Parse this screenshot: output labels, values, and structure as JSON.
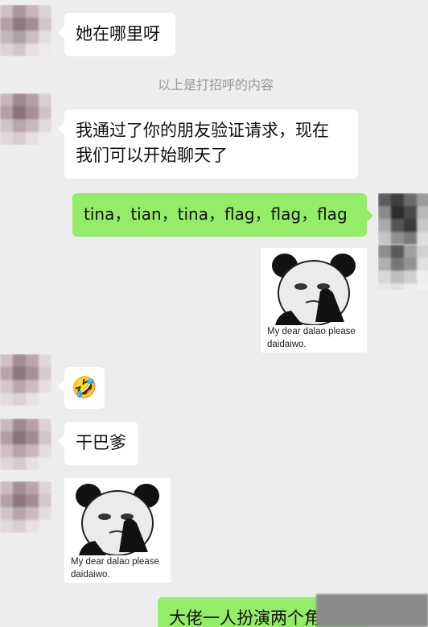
{
  "messages": [
    {
      "side": "in",
      "type": "text",
      "text": "她在哪里呀"
    },
    {
      "type": "system",
      "text": "以上是打招呼的内容"
    },
    {
      "side": "in",
      "type": "text",
      "lines": [
        "我通过了你的朋友验证请求，现在",
        "我们可以开始聊天了"
      ]
    },
    {
      "side": "out",
      "type": "text",
      "text": "tina，tian，tina，flag，flag，flag"
    },
    {
      "side": "out",
      "type": "sticker",
      "caption": "My dear dalao please\ndaidaiwo."
    },
    {
      "side": "in",
      "type": "emoji",
      "emoji": "🤣",
      "icon": "rofl-emoji-icon"
    },
    {
      "side": "in",
      "type": "text",
      "text": "干巴爹"
    },
    {
      "side": "in",
      "type": "sticker",
      "caption": "My dear dalao please\ndaidaiwo."
    },
    {
      "side": "out",
      "type": "text",
      "text": "大佬一人扮演两个角色？"
    }
  ],
  "colors": {
    "background": "#ededed",
    "incoming_bubble": "#ffffff",
    "outgoing_bubble": "#95ec69",
    "system_text": "#9a9a9a"
  }
}
